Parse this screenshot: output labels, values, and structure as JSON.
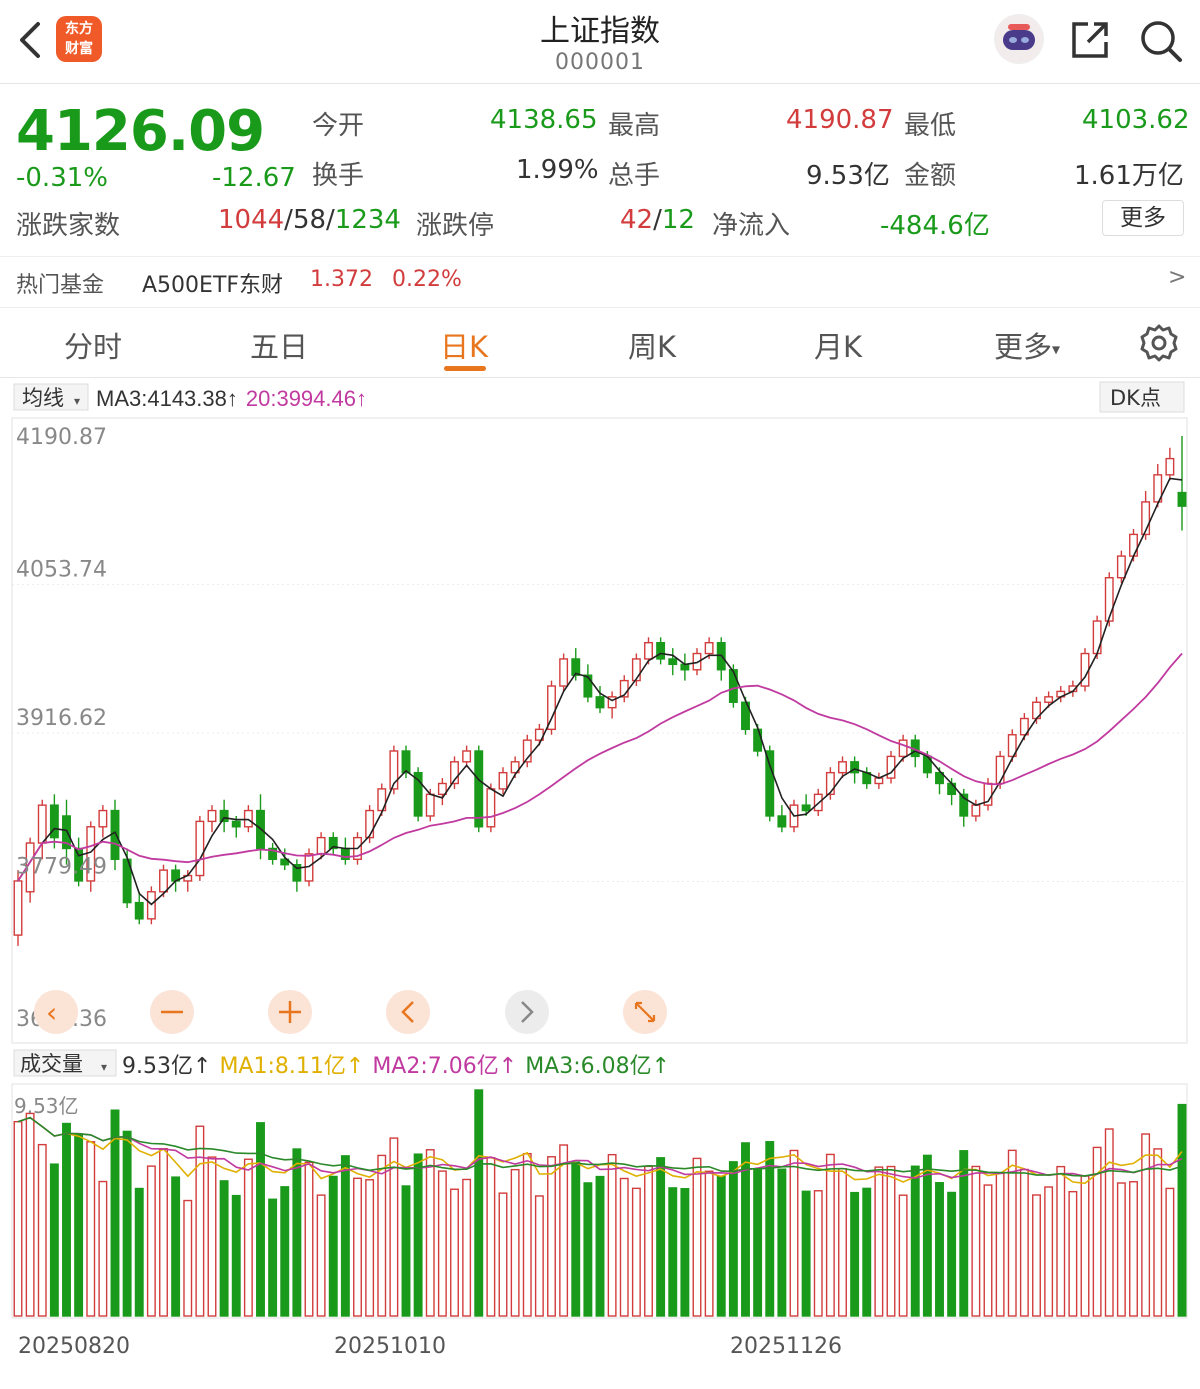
{
  "header": {
    "title": "上证指数",
    "code": "000001",
    "logo_text_1": "东方",
    "logo_text_2": "财富"
  },
  "quote": {
    "price": "4126.09",
    "change_pct": "-0.31%",
    "change": "-12.67",
    "open_label": "今开",
    "open": "4138.65",
    "high_label": "最高",
    "high": "4190.87",
    "low_label": "最低",
    "low": "4103.62",
    "turnover_label": "换手",
    "turnover": "1.99%",
    "volume_label": "总手",
    "volume": "9.53亿",
    "amount_label": "金额",
    "amount": "1.61万亿",
    "breadth_label": "涨跌家数",
    "breadth_up": "1044",
    "breadth_sep1": "/",
    "breadth_flat": "58",
    "breadth_sep2": "/",
    "breadth_down": "1234",
    "limit_label": "涨跌停",
    "limit_up": "42",
    "limit_sep": "/",
    "limit_down": "12",
    "netflow_label": "净流入",
    "netflow": "-484.6亿",
    "more_label": "更多"
  },
  "fund": {
    "label": "热门基金",
    "name": "A500ETF东财",
    "price": "1.372",
    "pct": "0.22%",
    "arrow": ">"
  },
  "tabs": [
    {
      "label": "分时"
    },
    {
      "label": "五日"
    },
    {
      "label": "日K"
    },
    {
      "label": "周K"
    },
    {
      "label": "月K"
    },
    {
      "label": "更多"
    }
  ],
  "indicator": {
    "ma_select": "均线",
    "ma3_text": "MA3:4143.38",
    "ma20_text": "20:3994.46",
    "arrow": "↑",
    "dk_label": "DK点"
  },
  "vol_indicator": {
    "select": "成交量",
    "vol_text": "9.53亿",
    "ma1_text": "MA1:8.11亿",
    "ma2_text": "MA2:7.06亿",
    "ma3_text": "MA3:6.08亿",
    "arrow": "↑",
    "axis_top": "9.53亿"
  },
  "colors": {
    "up": "#d23c3c",
    "down": "#1a9a1a",
    "ma_short": "#222222",
    "ma_long": "#c03aa0",
    "accent": "#e8761e",
    "vma1": "#e0b000",
    "vma2": "#c03aa0",
    "vma3": "#2a8a2a"
  },
  "icons": {
    "back": "back-arrow-icon",
    "share": "share-icon",
    "search": "search-icon",
    "settings": "gear-icon",
    "robot": "assistant-robot-icon"
  },
  "chart_data": {
    "type": "candlestick",
    "price_axis_labels": [
      "4190.87",
      "4053.74",
      "3916.62",
      "3779.49",
      "3642.36"
    ],
    "ylim": [
      3642.36,
      4190.87
    ],
    "date_labels": [
      "20250820",
      "20251010",
      "20251126"
    ],
    "candles": [
      [
        3730,
        3780,
        3720,
        3790
      ],
      [
        3770,
        3815,
        3760,
        3820
      ],
      [
        3815,
        3850,
        3800,
        3855
      ],
      [
        3850,
        3820,
        3810,
        3860
      ],
      [
        3840,
        3810,
        3795,
        3855
      ],
      [
        3810,
        3780,
        3775,
        3820
      ],
      [
        3780,
        3830,
        3770,
        3835
      ],
      [
        3830,
        3845,
        3820,
        3850
      ],
      [
        3845,
        3800,
        3790,
        3855
      ],
      [
        3800,
        3760,
        3755,
        3810
      ],
      [
        3760,
        3745,
        3740,
        3770
      ],
      [
        3745,
        3770,
        3740,
        3775
      ],
      [
        3770,
        3790,
        3765,
        3795
      ],
      [
        3790,
        3780,
        3770,
        3795
      ],
      [
        3780,
        3785,
        3770,
        3790
      ],
      [
        3785,
        3835,
        3780,
        3840
      ],
      [
        3835,
        3845,
        3825,
        3850
      ],
      [
        3845,
        3835,
        3825,
        3855
      ],
      [
        3835,
        3830,
        3820,
        3840
      ],
      [
        3830,
        3845,
        3825,
        3850
      ],
      [
        3845,
        3810,
        3800,
        3860
      ],
      [
        3810,
        3800,
        3795,
        3815
      ],
      [
        3800,
        3795,
        3790,
        3810
      ],
      [
        3795,
        3780,
        3770,
        3800
      ],
      [
        3780,
        3805,
        3775,
        3810
      ],
      [
        3805,
        3820,
        3800,
        3825
      ],
      [
        3820,
        3810,
        3805,
        3825
      ],
      [
        3810,
        3800,
        3795,
        3820
      ],
      [
        3800,
        3820,
        3795,
        3825
      ],
      [
        3820,
        3845,
        3815,
        3850
      ],
      [
        3845,
        3865,
        3840,
        3870
      ],
      [
        3865,
        3900,
        3860,
        3905
      ],
      [
        3900,
        3880,
        3875,
        3905
      ],
      [
        3880,
        3840,
        3835,
        3885
      ],
      [
        3840,
        3860,
        3835,
        3865
      ],
      [
        3860,
        3870,
        3850,
        3875
      ],
      [
        3870,
        3890,
        3865,
        3895
      ],
      [
        3890,
        3900,
        3885,
        3905
      ],
      [
        3900,
        3830,
        3825,
        3905
      ],
      [
        3830,
        3865,
        3825,
        3870
      ],
      [
        3865,
        3880,
        3860,
        3885
      ],
      [
        3880,
        3890,
        3875,
        3895
      ],
      [
        3890,
        3910,
        3885,
        3915
      ],
      [
        3910,
        3920,
        3905,
        3925
      ],
      [
        3920,
        3960,
        3915,
        3965
      ],
      [
        3960,
        3985,
        3955,
        3990
      ],
      [
        3985,
        3970,
        3965,
        3995
      ],
      [
        3970,
        3950,
        3945,
        3980
      ],
      [
        3950,
        3940,
        3935,
        3960
      ],
      [
        3940,
        3950,
        3930,
        3955
      ],
      [
        3950,
        3965,
        3945,
        3970
      ],
      [
        3965,
        3985,
        3960,
        3990
      ],
      [
        3985,
        4000,
        3980,
        4005
      ],
      [
        4000,
        3985,
        3980,
        4005
      ],
      [
        3985,
        3980,
        3970,
        3995
      ],
      [
        3980,
        3975,
        3965,
        3990
      ],
      [
        3975,
        3990,
        3970,
        3995
      ],
      [
        3990,
        4000,
        3985,
        4005
      ],
      [
        4000,
        3975,
        3965,
        4005
      ],
      [
        3975,
        3945,
        3940,
        3980
      ],
      [
        3945,
        3920,
        3915,
        3950
      ],
      [
        3920,
        3900,
        3895,
        3925
      ],
      [
        3900,
        3840,
        3835,
        3905
      ],
      [
        3840,
        3830,
        3825,
        3850
      ],
      [
        3830,
        3850,
        3825,
        3855
      ],
      [
        3850,
        3845,
        3840,
        3860
      ],
      [
        3845,
        3860,
        3840,
        3865
      ],
      [
        3860,
        3880,
        3855,
        3885
      ],
      [
        3880,
        3890,
        3875,
        3895
      ],
      [
        3890,
        3880,
        3870,
        3895
      ],
      [
        3880,
        3870,
        3865,
        3885
      ],
      [
        3870,
        3875,
        3865,
        3880
      ],
      [
        3875,
        3895,
        3870,
        3900
      ],
      [
        3895,
        3910,
        3890,
        3915
      ],
      [
        3910,
        3895,
        3885,
        3915
      ],
      [
        3895,
        3880,
        3875,
        3900
      ],
      [
        3880,
        3870,
        3860,
        3885
      ],
      [
        3870,
        3860,
        3850,
        3875
      ],
      [
        3860,
        3840,
        3830,
        3865
      ],
      [
        3840,
        3850,
        3835,
        3855
      ],
      [
        3850,
        3870,
        3845,
        3875
      ],
      [
        3870,
        3895,
        3865,
        3900
      ],
      [
        3895,
        3915,
        3890,
        3920
      ],
      [
        3915,
        3930,
        3910,
        3935
      ],
      [
        3930,
        3945,
        3925,
        3950
      ],
      [
        3945,
        3950,
        3940,
        3955
      ],
      [
        3950,
        3955,
        3945,
        3960
      ],
      [
        3955,
        3960,
        3950,
        3965
      ],
      [
        3960,
        3990,
        3955,
        3995
      ],
      [
        3990,
        4020,
        3985,
        4025
      ],
      [
        4020,
        4060,
        4015,
        4065
      ],
      [
        4060,
        4080,
        4055,
        4085
      ],
      [
        4080,
        4100,
        4075,
        4105
      ],
      [
        4100,
        4130,
        4095,
        4140
      ],
      [
        4130,
        4155,
        4125,
        4165
      ],
      [
        4155,
        4170,
        4150,
        4180
      ],
      [
        4138.65,
        4126.09,
        4103.62,
        4190.87
      ]
    ]
  }
}
